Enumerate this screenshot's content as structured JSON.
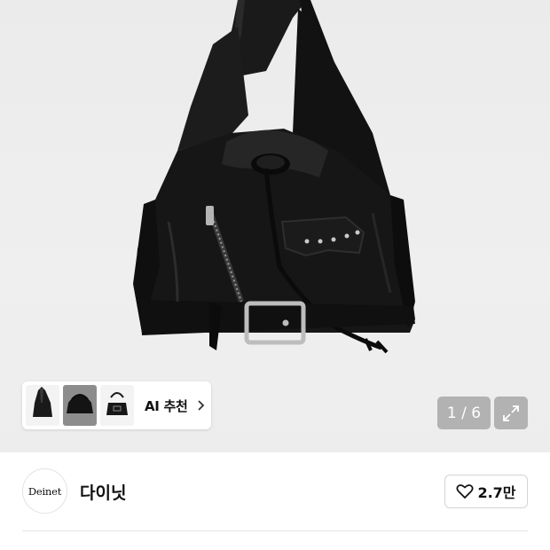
{
  "gallery": {
    "image_subject": "black leather drawstring bucket bag",
    "thumbnails": [
      {
        "icon": "bag-thumbnail",
        "selected": false
      },
      {
        "icon": "bag-thumbnail",
        "selected": true
      },
      {
        "icon": "bag-thumbnail",
        "selected": false
      }
    ],
    "ai_label": "AI 추천",
    "counter": "1 / 6",
    "expand_icon": "expand-icon"
  },
  "brand": {
    "logo_text": "Deinet",
    "name": "다이닛"
  },
  "like": {
    "icon": "heart-icon",
    "count": "2.7만"
  },
  "colors": {
    "background": "#ededed",
    "bag": "#151515",
    "overlay": "#8a8a8a"
  }
}
